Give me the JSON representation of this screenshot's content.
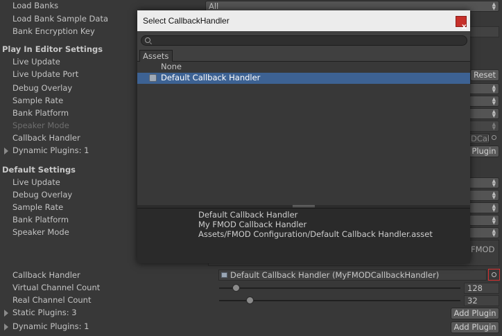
{
  "inspector": {
    "load_banks": {
      "label": "Load Banks",
      "value": "All"
    },
    "load_bank_sample_data": {
      "label": "Load Bank Sample Data"
    },
    "bank_encryption_key": {
      "label": "Bank Encryption Key"
    },
    "play_in_editor": {
      "header": "Play In Editor Settings",
      "live_update": "Live Update",
      "live_update_port": "Live Update Port",
      "reset_label": "Reset",
      "debug_overlay": "Debug Overlay",
      "sample_rate": "Sample Rate",
      "bank_platform": "Bank Platform",
      "speaker_mode": "Speaker Mode",
      "callback_handler": "Callback Handler",
      "callback_partial": "DCal",
      "dynamic_plugins": "Dynamic Plugins: 1",
      "plugin_btn_partial": "Plugin"
    },
    "default_settings": {
      "header": "Default Settings",
      "live_update": "Live Update",
      "debug_overlay": "Debug Overlay",
      "sample_rate": "Sample Rate",
      "bank_platform": "Bank Platform",
      "speaker_mode": "Speaker Mode",
      "textarea_partial": "FMOD",
      "callback_handler": "Callback Handler",
      "callback_value": "Default Callback Handler (MyFMODCallbackHandler)",
      "virtual_channel_count": "Virtual Channel Count",
      "virtual_channel_value": "128",
      "virtual_channel_level": 128,
      "real_channel_count": "Real Channel Count",
      "real_channel_value": "32",
      "real_channel_level": 32,
      "static_plugins": "Static Plugins: 3",
      "dynamic_plugins": "Dynamic Plugins: 1",
      "add_plugin": "Add Plugin"
    }
  },
  "modal": {
    "title": "Select CallbackHandler",
    "close_label": "x",
    "search_placeholder": "",
    "tab_assets": "Assets",
    "items": [
      {
        "label": "None"
      },
      {
        "label": "Default Callback Handler",
        "selected": true
      }
    ],
    "preview": {
      "line1": "Default Callback Handler",
      "line2": "My FMOD Callback Handler",
      "line3": "Assets/FMOD Configuration/Default Callback Handler.asset"
    }
  },
  "colors": {
    "selection": "#3d6293",
    "close_button": "#c6302a",
    "picker_highlight": "#d83030"
  },
  "icons": [
    "search-icon",
    "close-icon",
    "script-asset-icon",
    "object-picker-icon",
    "foldout-arrow-icon",
    "dropdown-arrow-icon"
  ]
}
